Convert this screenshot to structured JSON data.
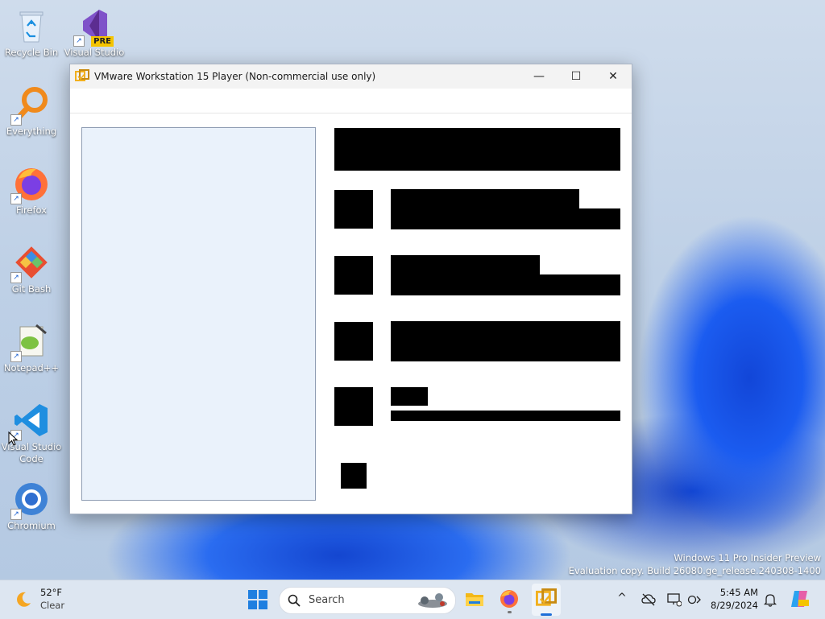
{
  "desktop": {
    "icons": [
      {
        "label": "Recycle Bin",
        "icon": "recycle-bin-icon"
      },
      {
        "label": "Visual Studio",
        "badge": "PRE",
        "icon": "visual-studio-icon"
      },
      {
        "label": "Everything",
        "icon": "everything-search-icon"
      },
      {
        "label": "Firefox",
        "icon": "firefox-icon"
      },
      {
        "label": "Git Bash",
        "icon": "git-bash-icon"
      },
      {
        "label": "Notepad++",
        "icon": "notepad-plus-plus-icon"
      },
      {
        "label": "Visual Studio Code",
        "icon": "vscode-icon"
      },
      {
        "label": "Chromium",
        "icon": "chromium-icon"
      }
    ],
    "watermark": {
      "line1": "Windows 11 Pro Insider Preview",
      "line2": "Evaluation copy. Build 26080.ge_release.240308-1400"
    }
  },
  "window": {
    "title": "VMware Workstation 15 Player (Non-commercial use only)",
    "controls": {
      "minimize": "—",
      "maximize": "☐",
      "close": "✕"
    },
    "accent": "#f2b01e"
  },
  "taskbar": {
    "weather": {
      "temp": "52°F",
      "condition": "Clear"
    },
    "search_placeholder": "Search",
    "clock": {
      "time": "5:45 AM",
      "date": "8/29/2024"
    },
    "tray_chevron": "^"
  }
}
